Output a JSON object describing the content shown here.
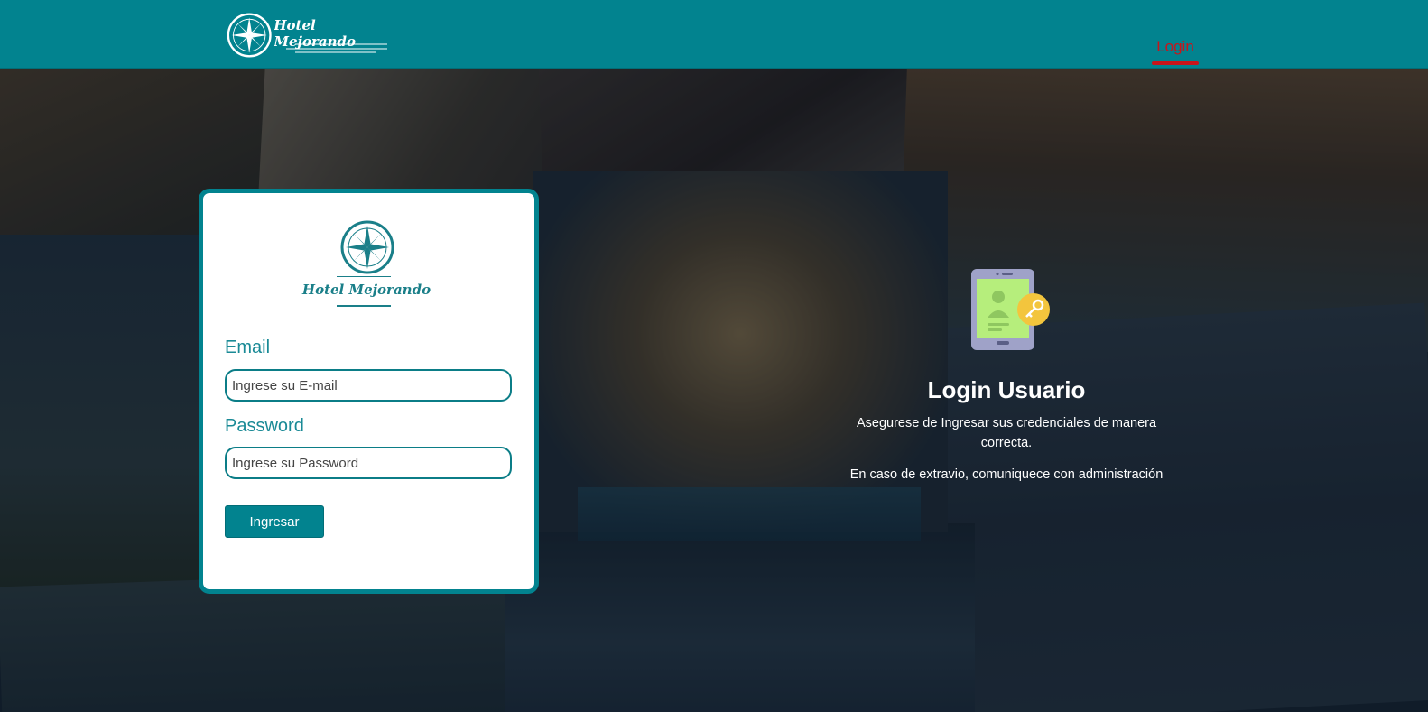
{
  "brand": {
    "name": "Hotel Mejorando",
    "color": "#02838f"
  },
  "nav": {
    "login_label": "Login",
    "active_color": "#c8151b"
  },
  "login_card": {
    "logo_text": "Hotel Mejorando",
    "email_label": "Email",
    "email_placeholder": "Ingrese su E-mail",
    "email_value": "",
    "password_label": "Password",
    "password_placeholder": "Ingrese su Password",
    "password_value": "",
    "submit_label": "Ingresar"
  },
  "info": {
    "icon": "tablet-user-key-icon",
    "title": "Login Usuario",
    "text1": "Asegurese de Ingresar sus credenciales de manera correcta.",
    "text2": "En caso de extravio, comuniquece con administración"
  }
}
